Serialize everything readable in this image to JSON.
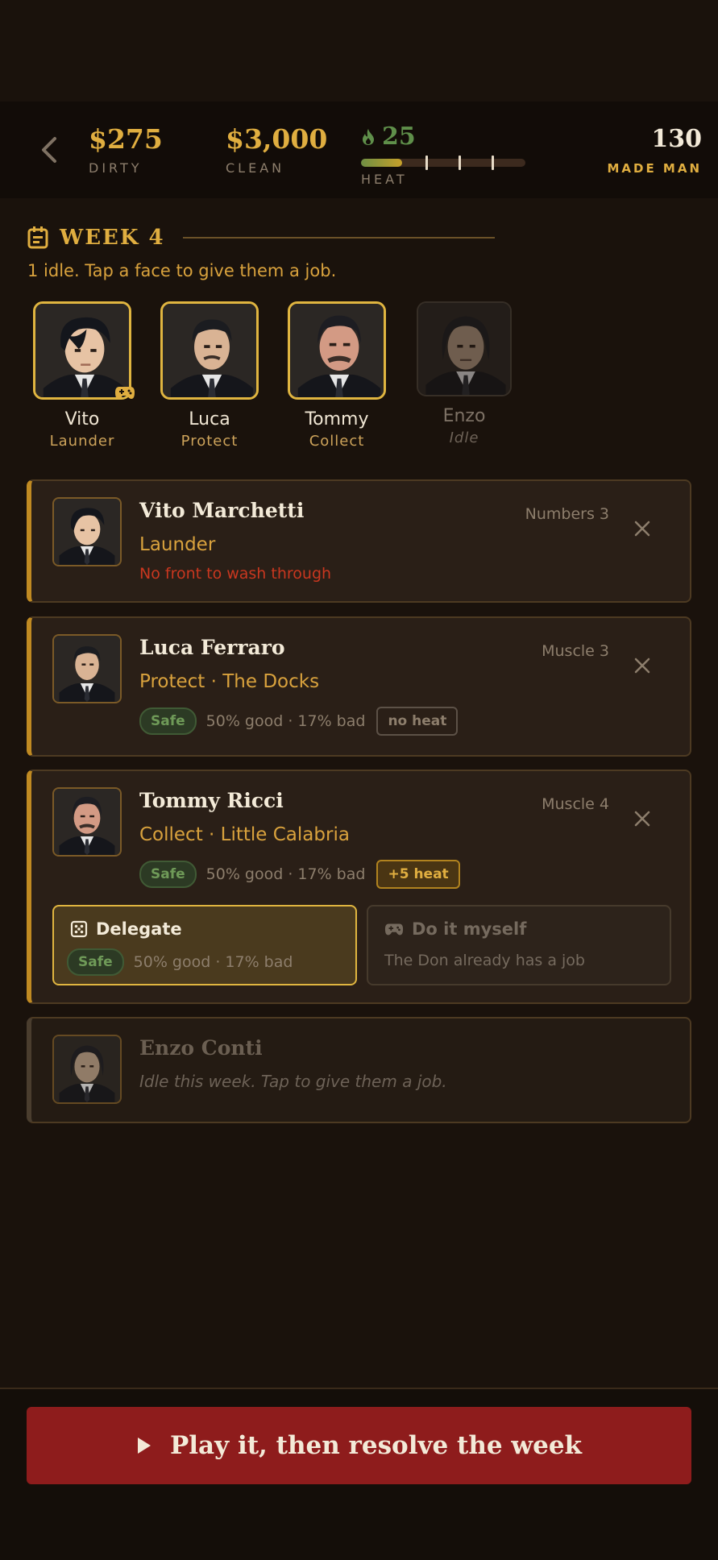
{
  "hud": {
    "dirty_value": "$275",
    "dirty_label": "DIRTY",
    "clean_value": "$3,000",
    "clean_label": "CLEAN",
    "heat_value": "25",
    "heat_label": "HEAT",
    "heat_level": 0.25,
    "rank_value": "130",
    "rank_label": "MADE MAN"
  },
  "week": {
    "title": "WEEK 4",
    "hint": "1 idle. Tap a face to give them a job."
  },
  "crew": [
    {
      "name": "Vito",
      "job": "Launder",
      "state": "assigned"
    },
    {
      "name": "Luca",
      "job": "Protect",
      "state": "assigned"
    },
    {
      "name": "Tommy",
      "job": "Collect",
      "state": "assigned"
    },
    {
      "name": "Enzo",
      "job": "Idle",
      "state": "idle"
    }
  ],
  "cards": {
    "vito": {
      "name": "Vito Marchetti",
      "skill": "Numbers 3",
      "task": "Launder",
      "warning": "No front to wash through"
    },
    "luca": {
      "name": "Luca Ferraro",
      "skill": "Muscle 3",
      "task": "Protect · The Docks",
      "safety": "Safe",
      "odds": "50% good · 17% bad",
      "heat": "no heat"
    },
    "tommy": {
      "name": "Tommy Ricci",
      "skill": "Muscle 4",
      "task": "Collect · Little Calabria",
      "safety": "Safe",
      "odds": "50% good · 17% bad",
      "heat": "+5 heat",
      "delegate": {
        "label": "Delegate",
        "safety": "Safe",
        "odds": "50% good · 17% bad"
      },
      "self": {
        "label": "Do it myself",
        "note": "The Don already has a job"
      }
    },
    "enzo": {
      "name": "Enzo Conti",
      "hint": "Idle this week. Tap to give them a job."
    }
  },
  "cta": {
    "label": "Play it, then resolve the week"
  },
  "colors": {
    "background": "#1a120c",
    "gold": "#e0ae40",
    "heat_green": "#5f8f4a",
    "warning_red": "#c9371f",
    "cta_red": "#8e1c1c"
  }
}
